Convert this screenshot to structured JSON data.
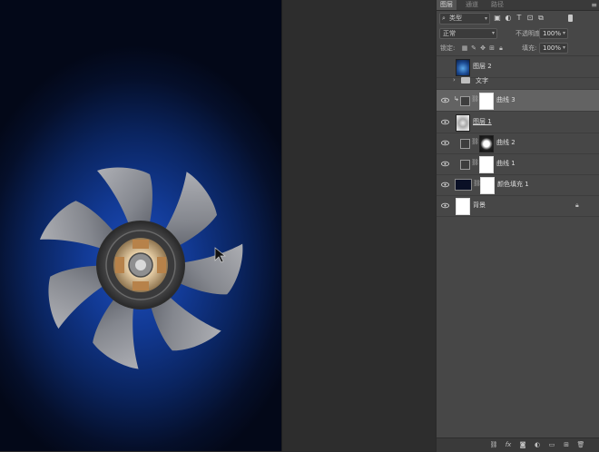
{
  "tabs": [
    {
      "label": "图层",
      "active": true
    },
    {
      "label": "通道",
      "active": false
    },
    {
      "label": "路径",
      "active": false
    }
  ],
  "panel_menu_icon": "hamburger-icon",
  "filter": {
    "label": "类型",
    "icon": "search-icon"
  },
  "filter_icons": [
    "image-filter-icon",
    "adjustment-filter-icon",
    "type-filter-icon",
    "shape-filter-icon",
    "smart-object-filter-icon"
  ],
  "blend_mode": "正常",
  "opacity": {
    "label": "不透明度:",
    "value": "100%"
  },
  "lock": {
    "label": "锁定:"
  },
  "lock_icons": [
    "lock-transparent-icon",
    "lock-paint-icon",
    "lock-position-icon",
    "lock-artboard-icon",
    "lock-all-icon"
  ],
  "fill": {
    "label": "填充:",
    "value": "100%"
  },
  "layers": [
    {
      "name": "图层 2",
      "visible": false,
      "type": "pixel",
      "selected": false
    },
    {
      "name": "文字",
      "visible": false,
      "type": "group",
      "selected": false
    },
    {
      "name": "曲线 3",
      "visible": true,
      "type": "adjustment",
      "selected": true,
      "clipped": true
    },
    {
      "name": "图层 1",
      "visible": true,
      "type": "pixel",
      "selected": false
    },
    {
      "name": "曲线 2",
      "visible": true,
      "type": "adjustment",
      "selected": false
    },
    {
      "name": "曲线 1",
      "visible": true,
      "type": "adjustment",
      "selected": false
    },
    {
      "name": "颜色填充 1",
      "visible": true,
      "type": "fill",
      "selected": false
    },
    {
      "name": "背景",
      "visible": true,
      "type": "background",
      "selected": false,
      "locked": true
    }
  ],
  "bottom_icons": [
    "link-layers-icon",
    "fx-icon",
    "add-mask-icon",
    "new-adjustment-icon",
    "new-group-icon",
    "new-layer-icon",
    "delete-layer-icon"
  ],
  "bottom_fx_label": "fx",
  "colors": {
    "canvas_center": "#1f4fbf",
    "canvas_edge": "#030818",
    "panel_bg": "#474747",
    "selected_row": "#636363"
  }
}
